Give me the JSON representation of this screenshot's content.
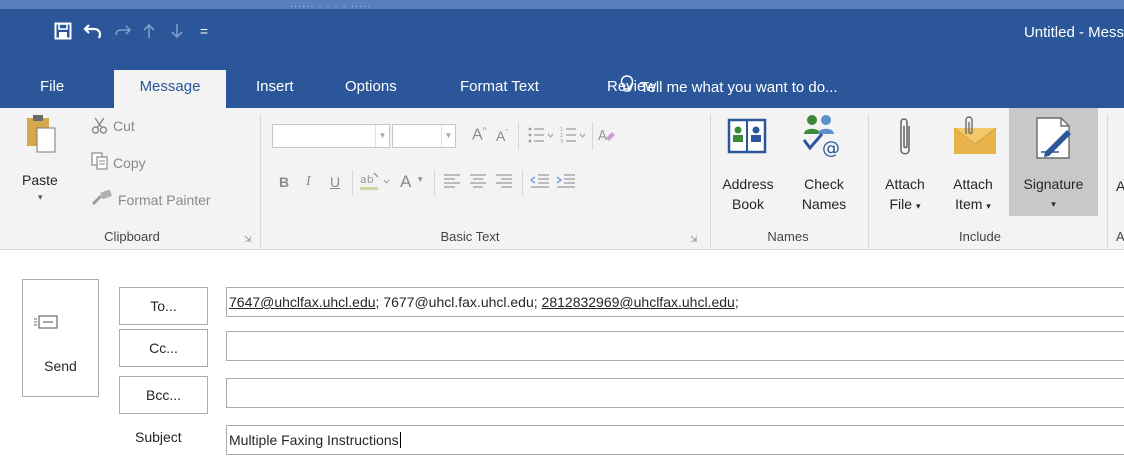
{
  "window": {
    "title": "Untitled - Mess",
    "ghost_text": "...... . . . . ....."
  },
  "quick_access": {
    "save": "save-icon",
    "undo": "undo-icon",
    "redo": "redo-icon",
    "up": "up-arrow-icon",
    "down": "down-arrow-icon",
    "customize": "="
  },
  "tabs": [
    "File",
    "Message",
    "Insert",
    "Options",
    "Format Text",
    "Review"
  ],
  "active_tab": "Message",
  "tell_me": "Tell me what you want to do...",
  "ribbon": {
    "clipboard": {
      "paste": "Paste",
      "cut": "Cut",
      "copy": "Copy",
      "format_painter": "Format Painter",
      "label": "Clipboard"
    },
    "basic_text": {
      "bold": "B",
      "italic": "I",
      "underline": "U",
      "font_color": "A",
      "label": "Basic Text"
    },
    "names": {
      "address_book_1": "Address",
      "address_book_2": "Book",
      "check_names_1": "Check",
      "check_names_2": "Names",
      "label": "Names"
    },
    "include": {
      "attach_file_1": "Attach",
      "attach_file_2": "File",
      "attach_item_1": "Attach",
      "attach_item_2": "Item",
      "signature": "Signature",
      "label": "Include"
    },
    "partial_label": "A"
  },
  "compose": {
    "send": "Send",
    "to_button": "To...",
    "cc_button": "Cc...",
    "bcc_button": "Bcc...",
    "subject_label": "Subject",
    "to_recipients": [
      "7647@uhclfax.uhcl.edu",
      "7677@uhcl.fax.uhcl.edu",
      "2812832969@uhclfax.uhcl.edu"
    ],
    "to_separator": "; ",
    "to_trailing": ";",
    "cc_value": "",
    "bcc_value": "",
    "subject_value": "Multiple Faxing Instructions"
  }
}
